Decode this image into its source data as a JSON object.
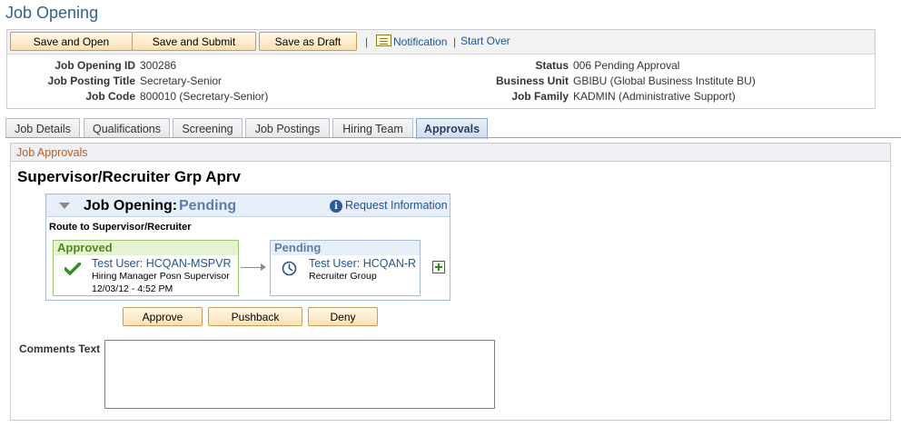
{
  "page": {
    "title": "Job Opening"
  },
  "toolbar": {
    "save_and_open": "Save and Open",
    "save_and_submit": "Save and Submit",
    "save_as_draft": "Save as Draft",
    "separator": "|",
    "notification": "Notification",
    "separator2": "|",
    "start_over": "Start Over"
  },
  "header_fields": {
    "job_opening_id": {
      "label": "Job Opening ID",
      "value": "300286"
    },
    "job_posting_title": {
      "label": "Job Posting Title",
      "value": "Secretary-Senior"
    },
    "job_code": {
      "label": "Job Code",
      "value": "800010 (Secretary-Senior)"
    },
    "status": {
      "label": "Status",
      "value": "006 Pending Approval"
    },
    "business_unit": {
      "label": "Business Unit",
      "value": "GBIBU (Global Business Institute BU)"
    },
    "job_family": {
      "label": "Job Family",
      "value": "KADMIN (Administrative Support)"
    }
  },
  "tabs": [
    "Job Details",
    "Qualifications",
    "Screening",
    "Job Postings",
    "Hiring Team",
    "Approvals"
  ],
  "active_tab": "Approvals",
  "section": {
    "title": "Job Approvals"
  },
  "stage": {
    "title": "Supervisor/Recruiter Grp Aprv"
  },
  "approval": {
    "name": "Job Opening:",
    "status": "Pending",
    "request_info": "Request Information",
    "info_glyph": "i",
    "route": "Route to Supervisor/Recruiter",
    "steps": [
      {
        "status": "Approved",
        "user": "Test User: HCQAN-MSPVR",
        "role": "Hiring Manager Posn Supervisor",
        "date": "12/03/12 - 4:52 PM",
        "icon": "checkmark-icon",
        "color": "#4e8b1a"
      },
      {
        "status": "Pending",
        "user": "Test User: HCQAN-R",
        "role": "Recruiter Group",
        "icon": "clock-icon",
        "color": "#5e7ea8"
      }
    ]
  },
  "actions": {
    "approve": "Approve",
    "pushback": "Pushback",
    "deny": "Deny"
  },
  "comments": {
    "label": "Comments Text",
    "value": ""
  },
  "colors": {
    "link": "#1f54a0",
    "title": "#32608f",
    "section_title": "#b85e1c",
    "button_bg": "#fbe1b0"
  }
}
